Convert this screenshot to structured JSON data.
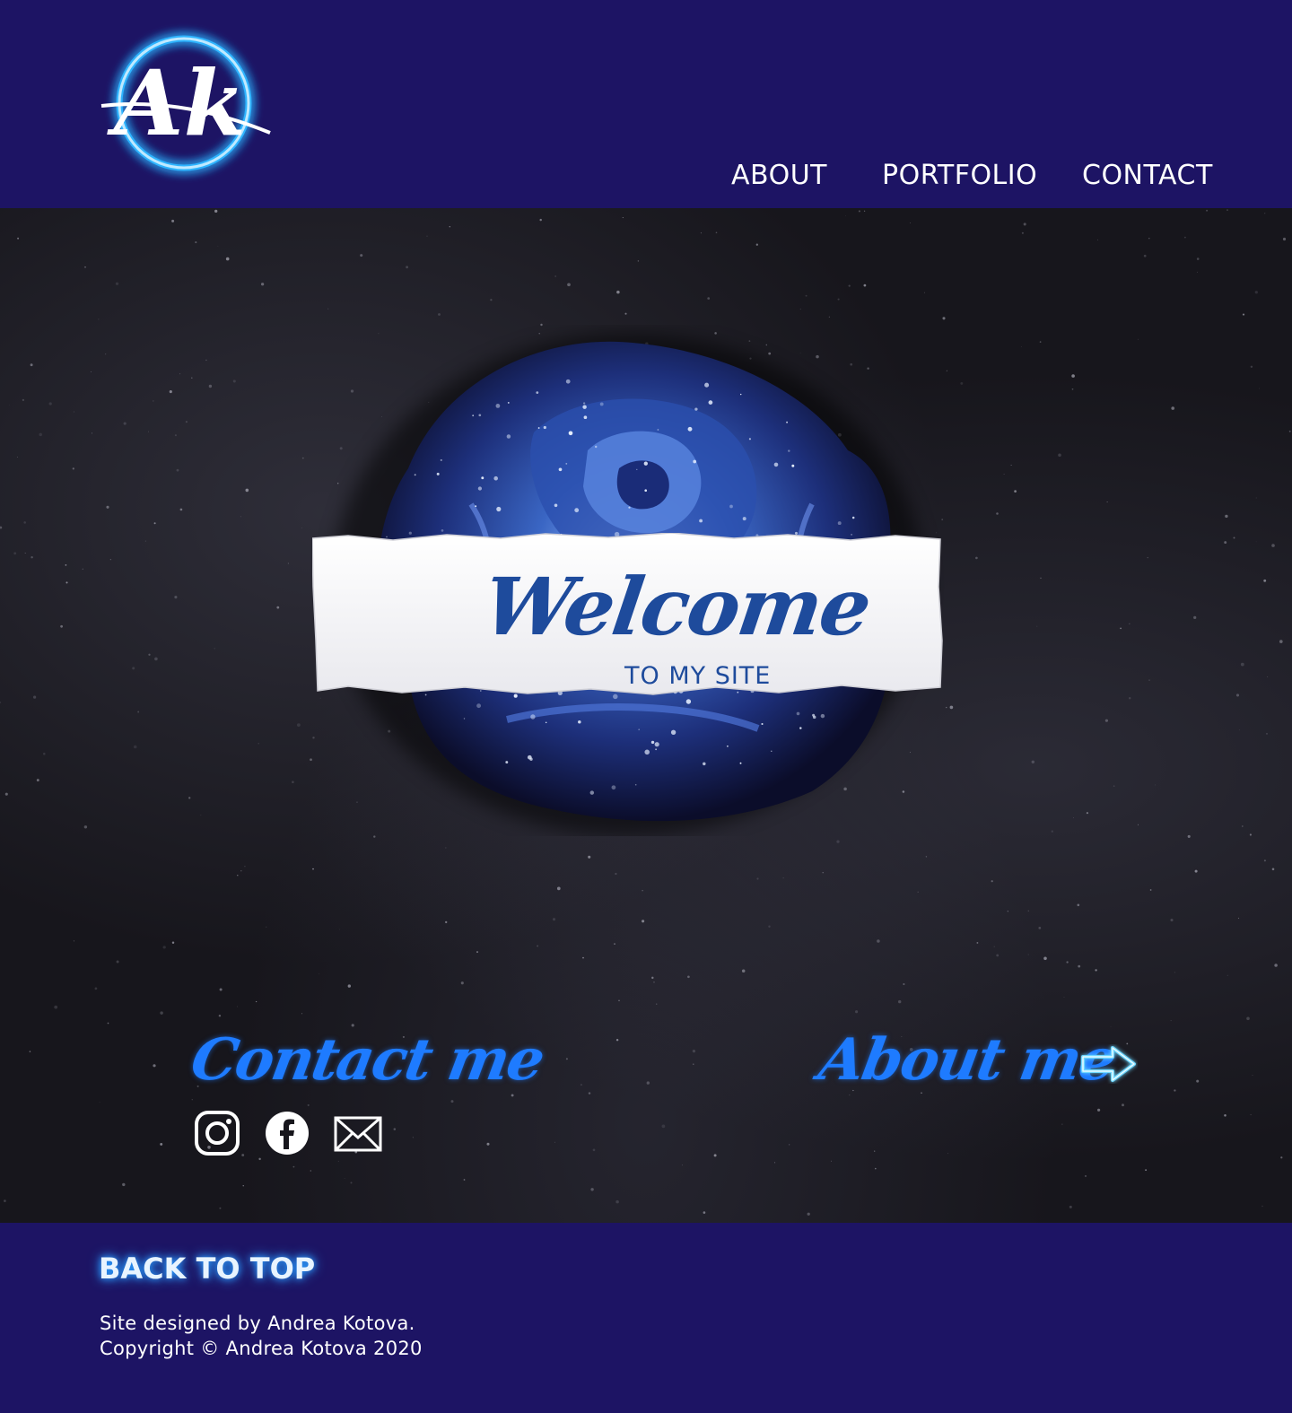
{
  "logo": {
    "initials": "Ak",
    "glow_color": "#2fb4ff"
  },
  "nav": {
    "items": [
      {
        "label": "ABOUT"
      },
      {
        "label": "PORTFOLIO"
      },
      {
        "label": "CONTACT"
      }
    ]
  },
  "hero": {
    "welcome": "Welcome",
    "subtitle": "TO MY SITE",
    "contact_label": "Contact me",
    "about_label": "About me",
    "accent_color": "#1e7bff",
    "social_icons": [
      "instagram-icon",
      "facebook-icon",
      "mail-icon"
    ]
  },
  "footer": {
    "back_to_top": "BACK TO TOP",
    "designed_by": "Site designed by Andrea Kotova.",
    "copyright": "Copyright © Andrea Kotova 2020"
  },
  "colors": {
    "header_bg": "#1d1464",
    "hero_bg": "#17161c",
    "welcome_text": "#1e4b9c"
  }
}
